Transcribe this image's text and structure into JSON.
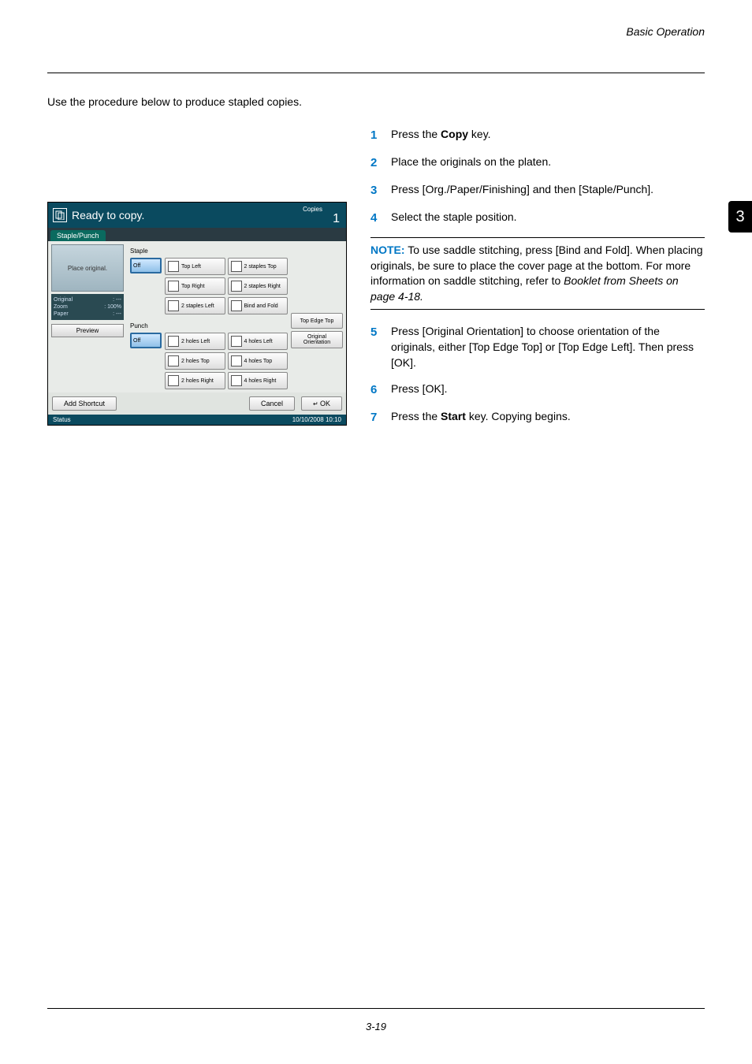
{
  "header": {
    "section": "Basic Operation"
  },
  "chapter_tab": "3",
  "intro": "Use the procedure below to produce stapled copies.",
  "steps_a": [
    {
      "n": "1",
      "pre": "Press the ",
      "bold": "Copy",
      "post": " key."
    },
    {
      "n": "2",
      "pre": "Place the originals on the platen.",
      "bold": "",
      "post": ""
    },
    {
      "n": "3",
      "pre": "Press [Org./Paper/Finishing] and then [Staple/Punch].",
      "bold": "",
      "post": ""
    },
    {
      "n": "4",
      "pre": "Select the staple position.",
      "bold": "",
      "post": ""
    }
  ],
  "note": {
    "label": "NOTE:",
    "body_a": " To use saddle stitching, press [Bind and Fold]. When placing originals, be sure to place the cover page at the bottom. For more information on saddle stitching, refer to ",
    "ref": "Booklet from Sheets on page 4-18.",
    "body_b": ""
  },
  "steps_b": [
    {
      "n": "5",
      "pre": "Press [Original Orientation] to choose orientation of the originals, either [Top Edge Top] or [Top Edge Left]. Then press [OK].",
      "bold": "",
      "post": ""
    },
    {
      "n": "6",
      "pre": "Press [OK].",
      "bold": "",
      "post": ""
    },
    {
      "n": "7",
      "pre": "Press the ",
      "bold": "Start",
      "post": " key. Copying begins."
    }
  ],
  "panel": {
    "title": "Ready to copy.",
    "copies_label": "Copies",
    "copies_value": "1",
    "tab": "Staple/Punch",
    "place_original": "Place original.",
    "info": {
      "original_lbl": "Original",
      "original_val": ": ---",
      "zoom_lbl": "Zoom",
      "zoom_val": ": 100%",
      "paper_lbl": "Paper",
      "paper_val": ": ---"
    },
    "preview_btn": "Preview",
    "staple_lbl": "Staple",
    "punch_lbl": "Punch",
    "off": "Off",
    "staple_opts": [
      "Top Left",
      "2 staples Top",
      "Top Right",
      "2 staples Right",
      "2 staples Left",
      "Bind and Fold"
    ],
    "punch_opts": [
      "2 holes Left",
      "4 holes Left",
      "2 holes Top",
      "4 holes Top",
      "2 holes Right",
      "4 holes Right"
    ],
    "orient_top": "Top Edge Top",
    "orient_btn": "Original Orientation",
    "add_shortcut": "Add Shortcut",
    "cancel": "Cancel",
    "ok": "OK",
    "status": "Status",
    "datetime": "10/10/2008   10:10"
  },
  "footer": "3-19"
}
